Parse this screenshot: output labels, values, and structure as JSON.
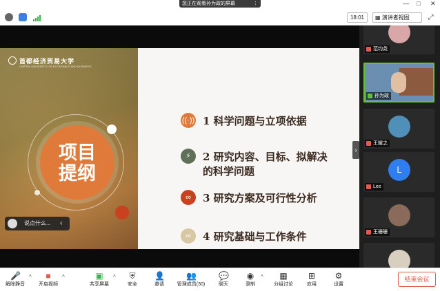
{
  "window": {
    "share_banner": "您正在观看孙为政的屏幕",
    "controls": [
      "—",
      "□",
      "✕"
    ]
  },
  "toolbar": {
    "clock": "18:01",
    "view_label": "演讲者视图",
    "view_icon": "grid-icon"
  },
  "slide": {
    "university": "首都经济贸易大学",
    "university_en": "CAPITAL UNIVERSITY OF ECONOMICS AND BUSINESS",
    "big_title_line1": "项目",
    "big_title_line2": "提纲",
    "items": [
      {
        "label": "1 科学问题与立项依据",
        "color": "#e07a3a",
        "icon": "broadcast-icon"
      },
      {
        "label": "2 研究内容、目标、拟解决",
        "label2": "的科学问题",
        "color": "#5f6f58",
        "icon": "lightning-icon"
      },
      {
        "label": "3 研究方案及可行性分析",
        "color": "#c9411f",
        "icon": "link-icon"
      },
      {
        "label": "4 研究基础与工作条件",
        "color": "#d8c7a3",
        "icon": "link-icon"
      }
    ]
  },
  "chat": {
    "placeholder": "说点什么...",
    "arrow": "‹"
  },
  "participants": [
    {
      "name": "范钧尧",
      "type": "photo"
    },
    {
      "name": "孙为政",
      "type": "video",
      "active": true
    },
    {
      "name": "王耀之",
      "type": "photo"
    },
    {
      "name": "Lee",
      "type": "letter",
      "letter": "L"
    },
    {
      "name": "王珊珊",
      "type": "photo"
    },
    {
      "name": "",
      "type": "photo"
    }
  ],
  "bottombar": {
    "buttons": [
      {
        "label": "解除静音",
        "icon": "mic-muted-icon"
      },
      {
        "label": "开启视频",
        "icon": "video-off-icon"
      },
      {
        "label": "共享屏幕",
        "icon": "share-screen-icon"
      },
      {
        "label": "安全",
        "icon": "shield-icon"
      },
      {
        "label": "邀请",
        "icon": "invite-icon"
      },
      {
        "label": "管理成员(30)",
        "icon": "members-icon"
      },
      {
        "label": "聊天",
        "icon": "chat-icon"
      },
      {
        "label": "录制",
        "icon": "record-icon"
      },
      {
        "label": "分组讨论",
        "icon": "breakout-icon"
      },
      {
        "label": "应用",
        "icon": "apps-icon"
      },
      {
        "label": "设置",
        "icon": "settings-icon"
      }
    ],
    "end_label": "结束会议"
  }
}
